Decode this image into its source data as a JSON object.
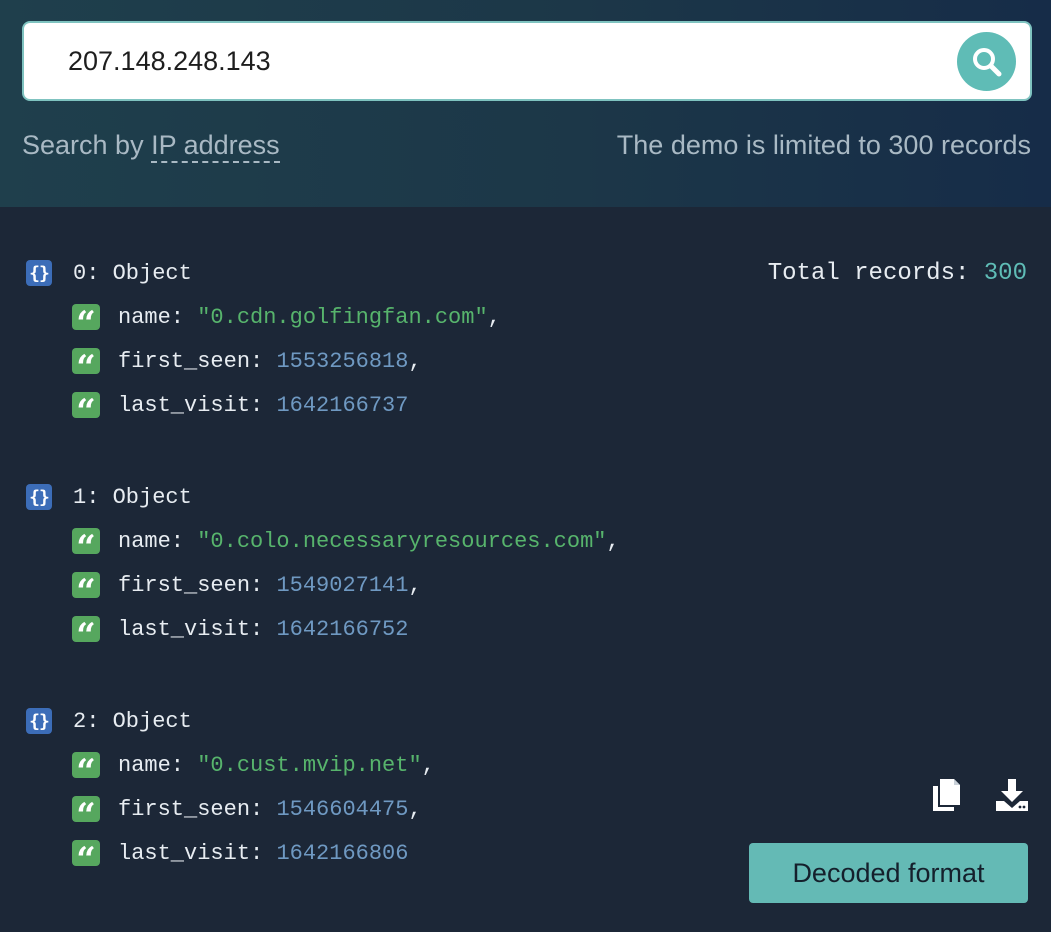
{
  "search": {
    "value": "207.148.248.143",
    "hint_prefix": "Search by ",
    "hint_link": "IP address",
    "limit_note": "The demo is limited to 300 records"
  },
  "results": {
    "total_label": "Total records: ",
    "total_value": "300",
    "records": [
      {
        "label": "0: Object",
        "name": "\"0.cdn.golfingfan.com\"",
        "first_seen": "1553256818",
        "last_visit": "1642166737"
      },
      {
        "label": "1: Object",
        "name": "\"0.colo.necessaryresources.com\"",
        "first_seen": "1549027141",
        "last_visit": "1642166752"
      },
      {
        "label": "2: Object",
        "name": "\"0.cust.mvip.net\"",
        "first_seen": "1546604475",
        "last_visit": "1642166806"
      }
    ],
    "keys": {
      "name": "name: ",
      "first_seen": "first_seen: ",
      "last_visit": "last_visit: "
    },
    "comma": ","
  },
  "actions": {
    "decoded_format_label": "Decoded format",
    "copy_icon": "copy-icon",
    "download_icon": "download-icon"
  },
  "colors": {
    "background": "#1c2737",
    "accent": "#5fbcb6",
    "string": "#57b46c",
    "number": "#6f99c2",
    "object_badge": "#3c6db8",
    "field_badge": "#56a75e"
  }
}
